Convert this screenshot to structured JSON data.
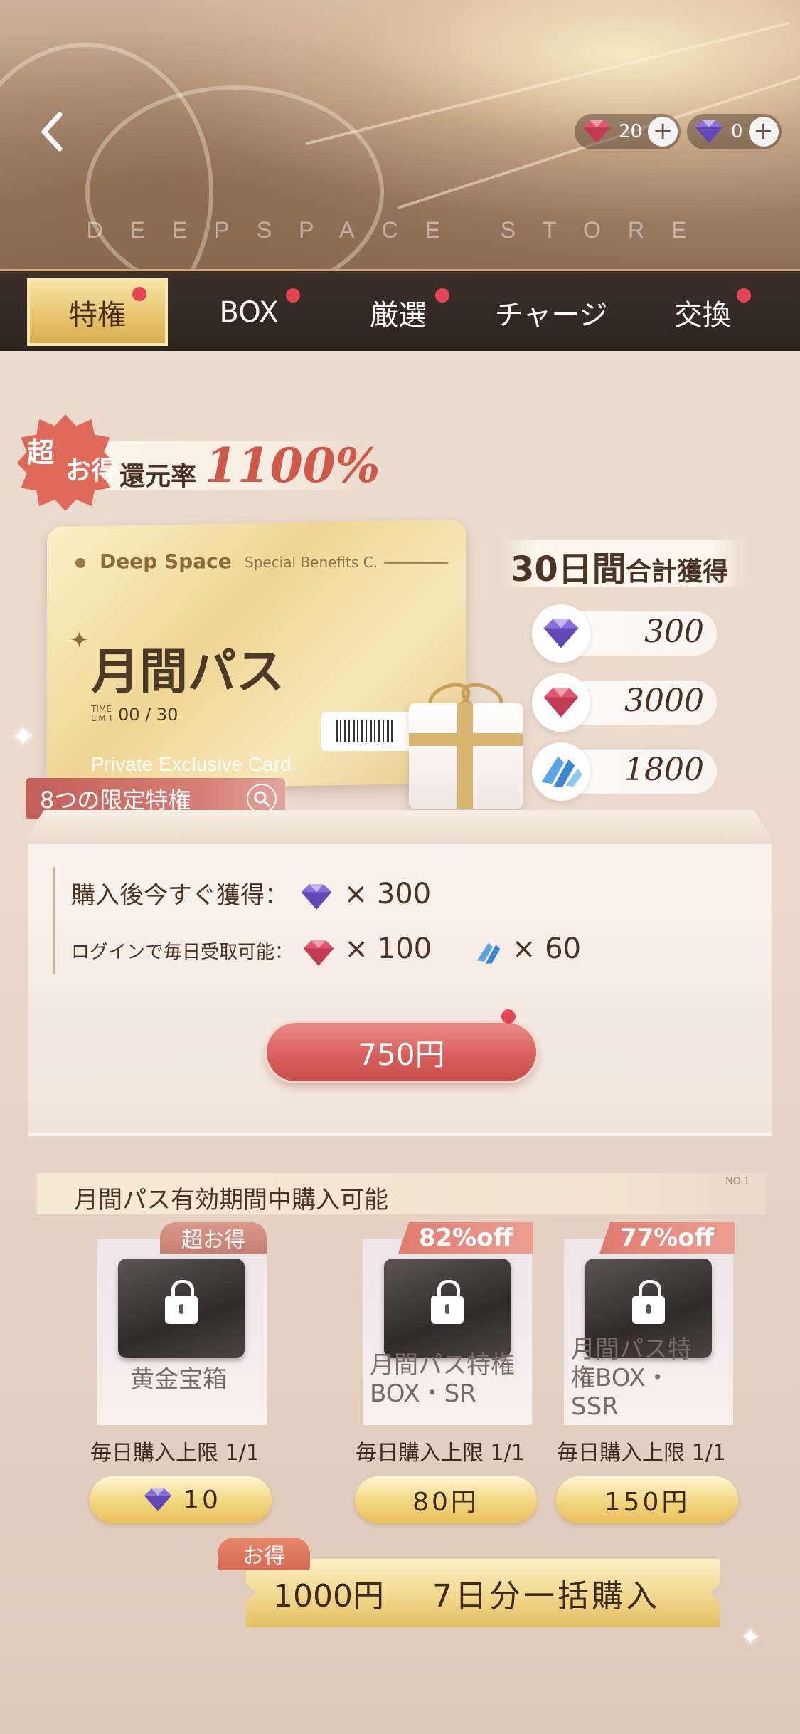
{
  "header": {
    "back_icon": "chevron-left-icon",
    "store_title": "DEEPSPACE STORE",
    "currencies": [
      {
        "icon": "red-diamond-icon",
        "value": "20"
      },
      {
        "icon": "purple-diamond-icon",
        "value": "0"
      }
    ],
    "plus_label": "+"
  },
  "tabs": [
    {
      "label": "特権",
      "active": true,
      "badge": true
    },
    {
      "label": "BOX",
      "active": false,
      "badge": true
    },
    {
      "label": "厳選",
      "active": false,
      "badge": true
    },
    {
      "label": "チャージ",
      "active": false,
      "badge": false
    },
    {
      "label": "交換",
      "active": false,
      "badge": true
    }
  ],
  "promo": {
    "cho": "超",
    "otoku": "お得",
    "label": "還元率",
    "rate": "1100%"
  },
  "pass_card": {
    "brand": "Deep Space",
    "subtitle": "Special Benefits C.",
    "title": "月間パス",
    "time_limit_tag": "TIME LIMIT",
    "time_limit": "00 / 30",
    "private": "Private Exclusive Card.",
    "limited_button": "8つの限定特権"
  },
  "thirty_days": {
    "title_main": "30日間",
    "title_sub": "合計獲得",
    "rewards": [
      {
        "icon": "purple-diamond-icon",
        "value": "300"
      },
      {
        "icon": "red-diamond-icon",
        "value": "3000"
      },
      {
        "icon": "blue-crystal-icon",
        "value": "1800"
      }
    ]
  },
  "details": {
    "immediate_label": "購入後今すぐ獲得：",
    "immediate_qty": "× 300",
    "daily_label": "ログインで毎日受取可能：",
    "daily_qty1": "× 100",
    "daily_qty2": "× 60",
    "price": "750円"
  },
  "extras": {
    "header": "月間パス有効期間中購入可能",
    "no_label": "NO.1",
    "items": [
      {
        "badge": "超お得",
        "name": "黄金宝箱",
        "limit": "毎日購入上限  1/1",
        "price": "10",
        "price_icon": "purple-diamond-icon"
      },
      {
        "badge": "82%off",
        "name": "月間パス特権BOX・SR",
        "limit": "毎日購入上限  1/1",
        "price": "80円"
      },
      {
        "badge": "77%off",
        "name": "月間パス特権BOX・SSR",
        "limit": "毎日購入上限  1/1",
        "price": "150円"
      }
    ]
  },
  "bulk": {
    "tag": "お得",
    "price": "1000円",
    "label": "7日分一括購入"
  }
}
